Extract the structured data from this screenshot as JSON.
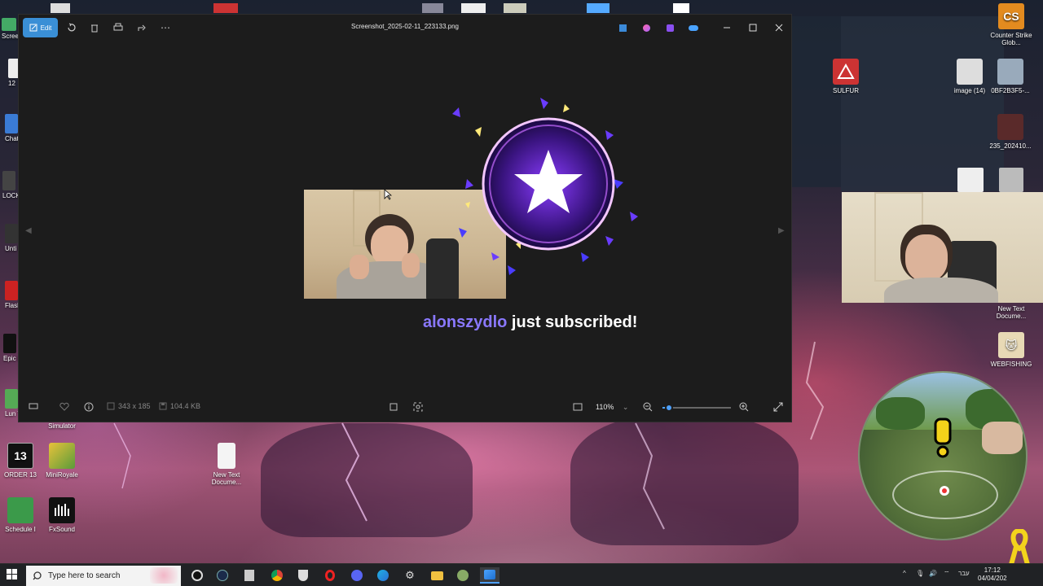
{
  "window": {
    "title": "Screenshot_2025-02-11_223133.png",
    "edit_label": "Edit"
  },
  "alert": {
    "username": "alonszydlo",
    "message": "just subscribed!",
    "username_color": "#8a78ff"
  },
  "bottombar": {
    "dimensions": "343 x 185",
    "filesize": "104.4 KB",
    "zoom": "110%",
    "zoom_fraction": 0.1
  },
  "desktop_icons_right": [
    {
      "label": "Counter Strike Glob..."
    },
    {
      "label": "SULFUR"
    },
    {
      "label": "image (14)"
    },
    {
      "label": "0BF2B3F5-..."
    },
    {
      "label": "235_202410..."
    },
    {
      "label": "New Text Docume..."
    },
    {
      "label": "WEBFISHING"
    }
  ],
  "desktop_icons_left": [
    {
      "label": "Screen"
    },
    {
      "label": "12"
    },
    {
      "label": "Chat"
    },
    {
      "label": "LOCK Pro"
    },
    {
      "label": "Unti De"
    },
    {
      "label": "Flash"
    },
    {
      "label": "Epic Laun"
    },
    {
      "label": "Lun Twitch..."
    },
    {
      "label": "Simulator"
    },
    {
      "label": "ORDER 13"
    },
    {
      "label": "MiniRoyale"
    },
    {
      "label": "Schedule I"
    },
    {
      "label": "FxSound"
    },
    {
      "label": "New Text Docume..."
    }
  ],
  "taskbar": {
    "search_placeholder": "Type here to search",
    "time": "17:12",
    "date": "04/04/202",
    "language": "עבר"
  },
  "colors": {
    "accent": "#3a8fd6",
    "window_bg": "#1c1c1c",
    "taskbar_bg": "#202225"
  }
}
